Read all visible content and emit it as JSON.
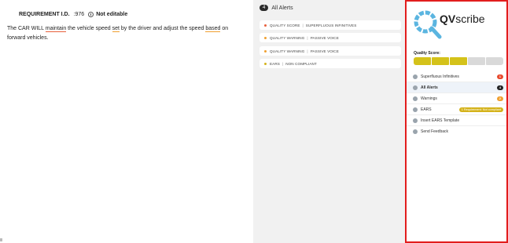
{
  "document": {
    "req_label": "REQUIREMENT I.D.",
    "req_id": ":976",
    "not_editable": "Not editable",
    "text": {
      "p1": "The CAR WILL ",
      "w1": "maintain",
      "p2": " the vehicle speed ",
      "w2": "set",
      "p3": " by the driver and adjust the speed ",
      "w3": "based",
      "p4": " on forward vehicles."
    }
  },
  "alerts": {
    "count": "4",
    "title": "All Alerts",
    "items": [
      {
        "category": "QUALITY SCORE",
        "detail": "SUPERFLUOUS INFINITIVES",
        "color": "#e8603c"
      },
      {
        "category": "QUALITY WARNING",
        "detail": "PASSIVE VOICE",
        "color": "#f0a030"
      },
      {
        "category": "QUALITY WARNING",
        "detail": "PASSIVE VOICE",
        "color": "#f0a030"
      },
      {
        "category": "EARS",
        "detail": "NON COMPLIANT",
        "color": "#d4b21a"
      }
    ]
  },
  "qvscribe": {
    "logo_prefix": "QV",
    "logo_suffix": "scribe",
    "quality_label": "Quality Score:",
    "quality_segments_filled": 3,
    "quality_segments_total": 5,
    "colors": {
      "filled": "#d4c21a",
      "empty": "#d9d9d9",
      "frame": "#e21d1d"
    },
    "menu": [
      {
        "label": "Superfluous Infinitives",
        "badge": "1",
        "badge_color": "#e84a2e",
        "icon": "gear-icon"
      },
      {
        "label": "All Alerts",
        "badge": "4",
        "badge_color": "#222222",
        "icon": "list-icon"
      },
      {
        "label": "Warnings",
        "badge": "2",
        "badge_color": "#f0a030",
        "icon": "warning-icon"
      },
      {
        "label": "EARS",
        "badge": "1 Requirement: Not compliant",
        "badge_color": "#d4b21a",
        "icon": "ears-icon"
      },
      {
        "label": "Insert EARS Template",
        "icon": "template-icon"
      },
      {
        "label": "Send Feedback",
        "icon": "feedback-icon"
      }
    ]
  }
}
